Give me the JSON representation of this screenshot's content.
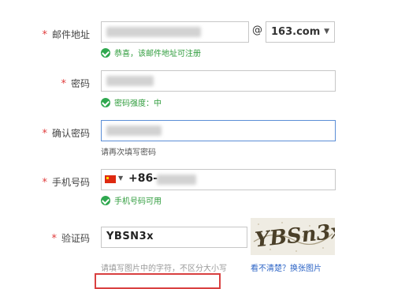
{
  "form": {
    "required_mark": "*",
    "email": {
      "label": "邮件地址",
      "at": "@",
      "domain_selected": "163.com",
      "status": "恭喜，该邮件地址可注册"
    },
    "password": {
      "label": "密码",
      "strength": "密码强度：中"
    },
    "confirm": {
      "label": "确认密码",
      "hint": "请再次填写密码"
    },
    "phone": {
      "label": "手机号码",
      "prefix": "+86-",
      "status": "手机号码可用"
    },
    "captcha": {
      "label": "验证码",
      "value": "YBSN3x",
      "image_text": "YBSn3x",
      "hint": "请填写图片中的字符，不区分大小写",
      "refresh_link": "看不清楚？换张图片"
    }
  },
  "colors": {
    "required": "#e03c3c",
    "success": "#2f9c3c",
    "focus_border": "#5b8ed6",
    "link": "#2c64c6",
    "highlight_box": "#d94040"
  },
  "icons": {
    "check": "check-circle-icon",
    "dropdown": "chevron-down-icon",
    "flag": "china-flag-icon"
  }
}
